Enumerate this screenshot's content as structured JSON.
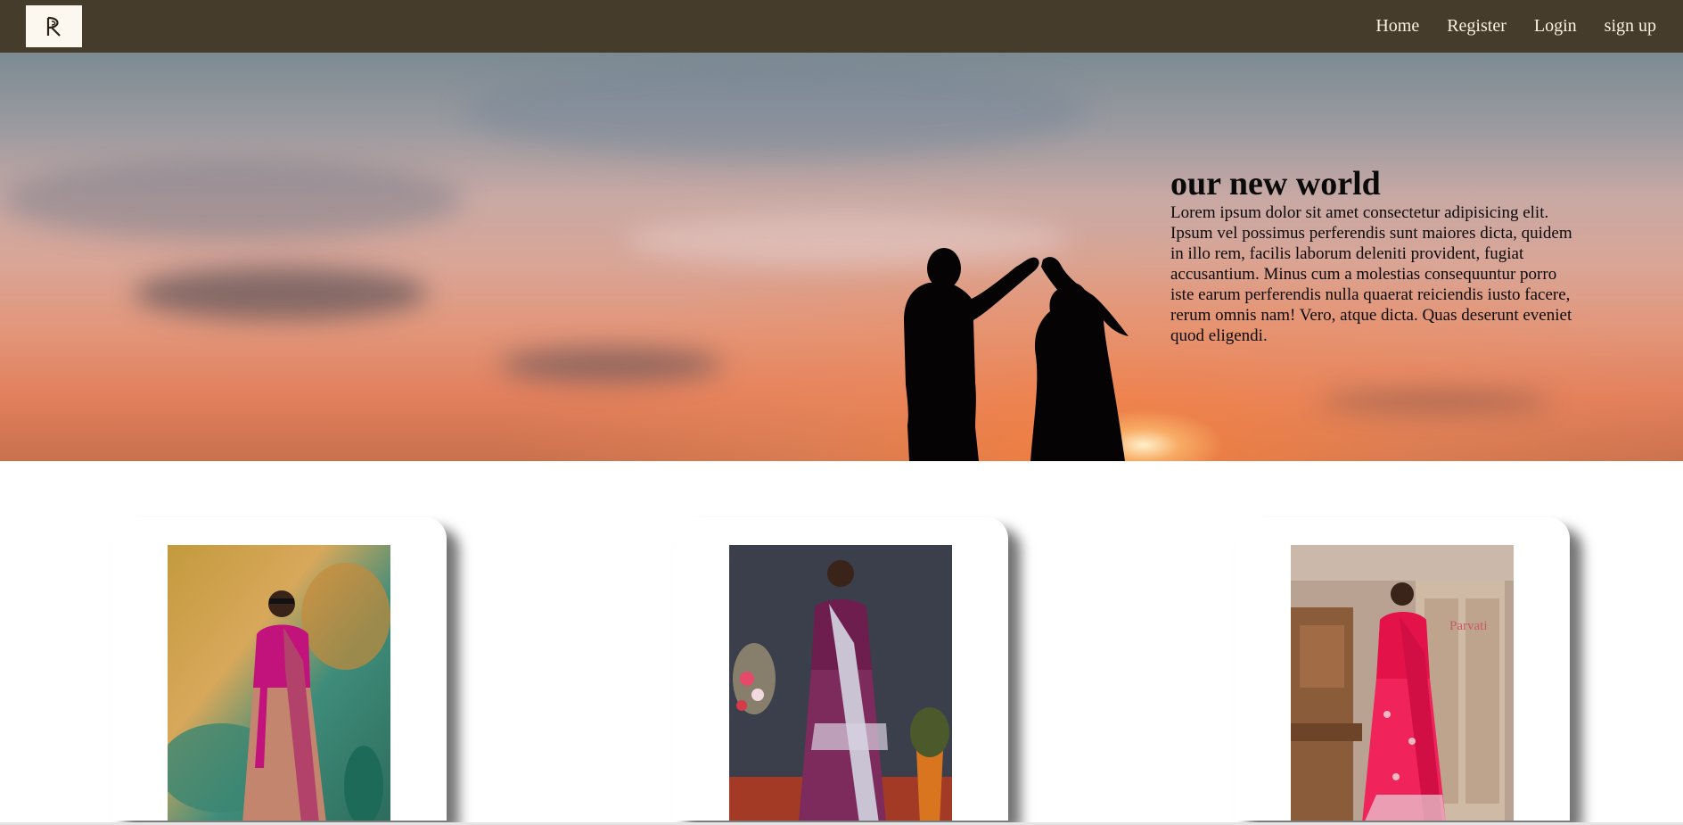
{
  "navbar": {
    "logo_alt": "logo",
    "links": [
      {
        "label": "Home"
      },
      {
        "label": "Register"
      },
      {
        "label": "Login"
      },
      {
        "label": "sign up"
      }
    ],
    "background": "#453c2b",
    "text_color": "#fbf3df"
  },
  "hero": {
    "title": "our new world",
    "body": "Lorem ipsum dolor sit amet consectetur adipisicing elit. Ipsum vel possimus perferendis sunt maiores dicta, quidem in illo rem, facilis laborum deleniti provident, fugiat accusantium. Minus cum a molestias consequuntur porro iste earum perferendis nulla quaerat reiciendis iusto facere, rerum omnis nam! Vero, atque dicta. Quas deserunt eveniet quod eligendi."
  },
  "products": [
    {
      "image_desc": "saree-magenta-gold"
    },
    {
      "image_desc": "saree-purple-silver"
    },
    {
      "image_desc": "saree-pink-red"
    }
  ]
}
